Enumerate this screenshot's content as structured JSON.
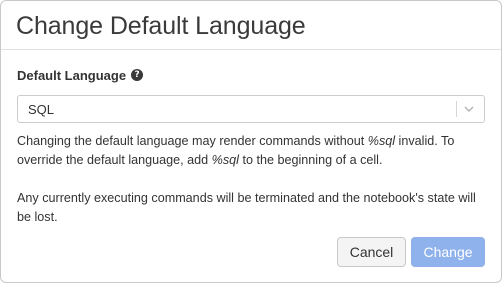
{
  "dialog": {
    "title": "Change Default Language",
    "field_label": "Default Language",
    "help_icon_glyph": "?",
    "select": {
      "value": "SQL"
    },
    "description": {
      "p1_a": "Changing the default language may render commands without ",
      "p1_em1": "%sql",
      "p1_b": " invalid. To override the default language, add ",
      "p1_em2": "%sql",
      "p1_c": " to the beginning of a cell.",
      "p2": "Any currently executing commands will be terminated and the notebook's state will be lost."
    },
    "buttons": {
      "cancel": "Cancel",
      "change": "Change"
    }
  },
  "colors": {
    "primary_button": "#8fb2ec",
    "border": "#c9c9c9"
  }
}
